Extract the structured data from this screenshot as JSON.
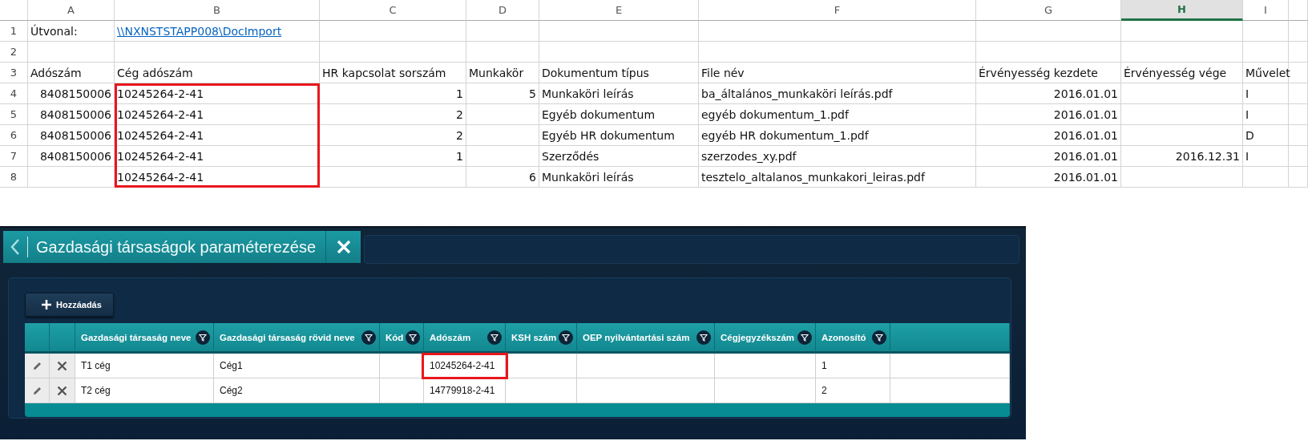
{
  "sheet": {
    "columns": [
      {
        "letter": "A",
        "selected": false,
        "numeric": true,
        "outlined": false
      },
      {
        "letter": "B",
        "selected": false,
        "numeric": false,
        "outlined": true
      },
      {
        "letter": "C",
        "selected": false,
        "numeric": true,
        "outlined": false
      },
      {
        "letter": "D",
        "selected": false,
        "numeric": true,
        "outlined": false
      },
      {
        "letter": "E",
        "selected": false,
        "numeric": false,
        "outlined": false
      },
      {
        "letter": "F",
        "selected": false,
        "numeric": false,
        "outlined": false
      },
      {
        "letter": "G",
        "selected": false,
        "numeric": true,
        "outlined": false
      },
      {
        "letter": "H",
        "selected": true,
        "numeric": true,
        "outlined": false
      },
      {
        "letter": "I",
        "selected": false,
        "numeric": false,
        "outlined": false
      }
    ],
    "rows": [
      {
        "number": "1",
        "kind": "path",
        "outlined": false,
        "cells": [
          "Útvonal:",
          "\\\\NXNSTSTAPP008\\DocImport"
        ]
      },
      {
        "number": "2",
        "outlined": false,
        "cells": []
      },
      {
        "number": "3",
        "kind": "text",
        "outlined": false,
        "cells": [
          "Adószám",
          "Cég adószám",
          "HR kapcsolat sorszám",
          "Munkakör",
          "Dokumentum típus",
          "File név",
          "Érvényesség kezdete",
          "Érvényesség vége",
          "Művelet"
        ]
      },
      {
        "number": "4",
        "kind": "data",
        "outlined": true,
        "cells": [
          "8408150006",
          "10245264-2-41",
          "1",
          "5",
          "Munkaköri leírás",
          "ba_általános_munkaköri leírás.pdf",
          "2016.01.01",
          null,
          "I"
        ]
      },
      {
        "number": "5",
        "kind": "data",
        "outlined": true,
        "cells": [
          "8408150006",
          "10245264-2-41",
          "2",
          null,
          "Egyéb dokumentum",
          "egyéb dokumentum_1.pdf",
          "2016.01.01",
          null,
          "I"
        ]
      },
      {
        "number": "6",
        "kind": "data",
        "outlined": true,
        "cells": [
          "8408150006",
          "10245264-2-41",
          "2",
          null,
          "Egyéb HR dokumentum",
          "egyéb HR dokumentum_1.pdf",
          "2016.01.01",
          null,
          "D"
        ]
      },
      {
        "number": "7",
        "kind": "data",
        "outlined": true,
        "cells": [
          "8408150006",
          "10245264-2-41",
          "1",
          null,
          "Szerződés",
          "szerzodes_xy.pdf",
          "2016.01.01",
          "2016.12.31",
          "I"
        ]
      },
      {
        "number": "8",
        "kind": "data",
        "outlined": true,
        "cells": [
          null,
          "10245264-2-41",
          null,
          "6",
          "Munkaköri leírás",
          "tesztelo_altalanos_munkakori_leiras.pdf",
          "2016.01.01"
        ]
      }
    ]
  },
  "app": {
    "tab": {
      "title": "Gazdasági társaságok paraméterezése"
    },
    "add_button": {
      "label": "Hozzáadás"
    },
    "table": {
      "columns": [
        {
          "label": "Gazdasági társaság neve",
          "outlined": false
        },
        {
          "label": "Gazdasági társaság rövid neve",
          "outlined": false
        },
        {
          "label": "Kód",
          "outlined": false
        },
        {
          "label": "Adószám",
          "outlined": true
        },
        {
          "label": "KSH szám",
          "outlined": false
        },
        {
          "label": "OEP nyilvántartási szám",
          "outlined": false
        },
        {
          "label": "Cégjegyzékszám",
          "outlined": false
        },
        {
          "label": "Azonosító",
          "outlined": false
        }
      ],
      "rows": [
        {
          "outlined": true,
          "cells": [
            "T1 cég",
            "Cég1",
            null,
            "10245264-2-41",
            null,
            null,
            null,
            "1"
          ]
        },
        {
          "outlined": false,
          "cells": [
            "T2 cég",
            "Cég2",
            null,
            "14779918-2-41",
            null,
            null,
            null,
            "2"
          ]
        }
      ]
    }
  }
}
